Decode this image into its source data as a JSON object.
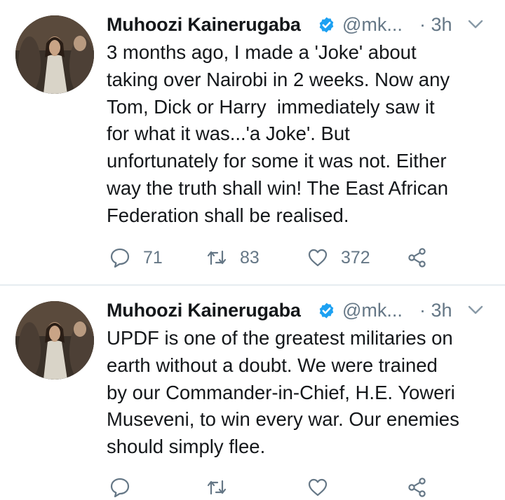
{
  "tweets": [
    {
      "author": "Muhoozi Kainerugaba",
      "handle": "@mk...",
      "time": "· 3h",
      "lines": [
        "3 months ago, I made a 'Joke' about",
        "taking over Nairobi in 2 weeks. Now any",
        "Tom, Dick or Harry  immediately saw it",
        "for what it was...'a Joke'. But",
        "unfortunately for some it was not. Either",
        "way the truth shall win! The East African",
        "Federation shall be realised."
      ],
      "replies": "71",
      "retweets": "83",
      "likes": "372"
    },
    {
      "author": "Muhoozi Kainerugaba",
      "handle": "@mk...",
      "time": "· 3h",
      "lines": [
        "UPDF is one of the greatest militaries on",
        "earth without a doubt. We were trained",
        "by our Commander-in-Chief, H.E. Yoweri",
        "Museveni, to win every war. Our enemies",
        "should simply flee."
      ]
    }
  ],
  "icons": {
    "verified": "verified-badge-icon",
    "chevron": "chevron-down-icon",
    "reply": "reply-icon",
    "retweet": "retweet-icon",
    "like": "heart-icon",
    "share": "share-icon"
  },
  "colors": {
    "text": "#14171a",
    "muted": "#657786",
    "verified": "#1da1f2",
    "divider": "#e6ecf0"
  }
}
